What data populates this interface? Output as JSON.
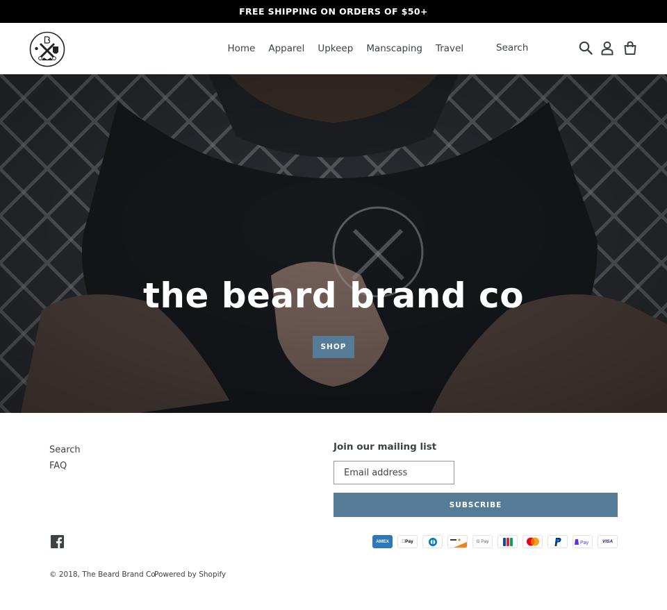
{
  "announcement": {
    "text": "FREE SHIPPING ON ORDERS OF $50+"
  },
  "header": {
    "nav": [
      "Home",
      "Apparel",
      "Upkeep",
      "Manscaping",
      "Travel"
    ],
    "search_label": "Search"
  },
  "hero": {
    "title": "the beard brand co",
    "button_label": "SHOP"
  },
  "footer": {
    "links": [
      "Search",
      "FAQ"
    ],
    "mailing_heading": "Join our mailing list",
    "email_placeholder": "Email address",
    "subscribe_label": "SUBSCRIBE",
    "copyright": "© 2018, The Beard Brand Co",
    "powered": "Powered by Shopify",
    "payment_icons": [
      "amex-icon",
      "apple-pay-icon",
      "diners-club-icon",
      "discover-icon",
      "google-pay-icon",
      "jcb-icon",
      "mastercard-icon",
      "paypal-icon",
      "shopify-pay-icon",
      "visa-icon"
    ]
  },
  "colors": {
    "accent": "#557b97",
    "announcement_bg": "#000000",
    "text": "#3d4246"
  }
}
